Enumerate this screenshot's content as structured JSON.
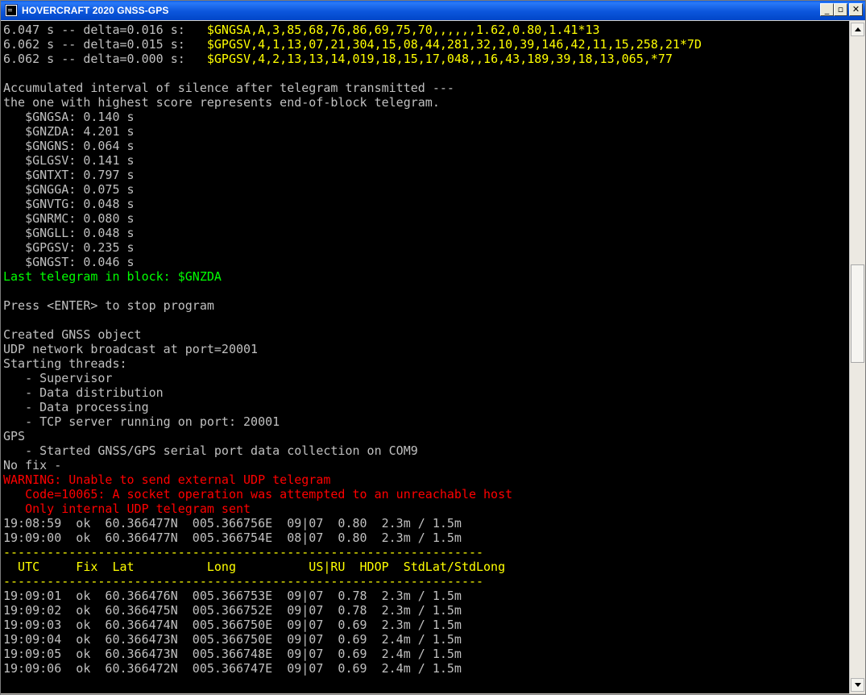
{
  "window": {
    "title": "HOVERCRAFT 2020 GNSS-GPS"
  },
  "controls": {
    "minimize": "_",
    "maximize": "▫",
    "close": "✕"
  },
  "console": {
    "lines": [
      {
        "text": "6.047 s -- delta=0.016 s:   ",
        "color": "gray",
        "tail": "$GNGSA,A,3,85,68,76,86,69,75,70,,,,,,1.62,0.80,1.41*13",
        "tail_color": "yellow"
      },
      {
        "text": "6.062 s -- delta=0.015 s:   ",
        "color": "gray",
        "tail": "$GPGSV,4,1,13,07,21,304,15,08,44,281,32,10,39,146,42,11,15,258,21*7D",
        "tail_color": "yellow"
      },
      {
        "text": "6.062 s -- delta=0.000 s:   ",
        "color": "gray",
        "tail": "$GPGSV,4,2,13,13,14,019,18,15,17,048,,16,43,189,39,18,13,065,*77",
        "tail_color": "yellow"
      },
      {
        "text": "",
        "color": "gray"
      },
      {
        "text": "Accumulated interval of silence after telegram transmitted ---",
        "color": "gray"
      },
      {
        "text": "the one with highest score represents end-of-block telegram.",
        "color": "gray"
      },
      {
        "text": "   $GNGSA: 0.140 s",
        "color": "gray"
      },
      {
        "text": "   $GNZDA: 4.201 s",
        "color": "gray"
      },
      {
        "text": "   $GNGNS: 0.064 s",
        "color": "gray"
      },
      {
        "text": "   $GLGSV: 0.141 s",
        "color": "gray"
      },
      {
        "text": "   $GNTXT: 0.797 s",
        "color": "gray"
      },
      {
        "text": "   $GNGGA: 0.075 s",
        "color": "gray"
      },
      {
        "text": "   $GNVTG: 0.048 s",
        "color": "gray"
      },
      {
        "text": "   $GNRMC: 0.080 s",
        "color": "gray"
      },
      {
        "text": "   $GNGLL: 0.048 s",
        "color": "gray"
      },
      {
        "text": "   $GPGSV: 0.235 s",
        "color": "gray"
      },
      {
        "text": "   $GNGST: 0.046 s",
        "color": "gray"
      },
      {
        "text": "Last telegram in block: $GNZDA",
        "color": "green"
      },
      {
        "text": "",
        "color": "gray"
      },
      {
        "text": "Press <ENTER> to stop program",
        "color": "gray"
      },
      {
        "text": "",
        "color": "gray"
      },
      {
        "text": "Created GNSS object",
        "color": "gray"
      },
      {
        "text": "UDP network broadcast at port=20001",
        "color": "gray"
      },
      {
        "text": "Starting threads:",
        "color": "gray"
      },
      {
        "text": "   - Supervisor",
        "color": "gray"
      },
      {
        "text": "   - Data distribution",
        "color": "gray"
      },
      {
        "text": "   - Data processing",
        "color": "gray"
      },
      {
        "text": "   - TCP server running on port: 20001",
        "color": "gray"
      },
      {
        "text": "GPS",
        "color": "gray"
      },
      {
        "text": "   - Started GNSS/GPS serial port data collection on COM9",
        "color": "gray"
      },
      {
        "text": "No fix -",
        "color": "gray"
      },
      {
        "text": "WARNING: Unable to send external UDP telegram",
        "color": "red"
      },
      {
        "text": "   Code=10065: A socket operation was attempted to an unreachable host",
        "color": "red"
      },
      {
        "text": "   Only internal UDP telegram sent",
        "color": "red"
      },
      {
        "text": "19:08:59  ok  60.366477N  005.366756E  09|07  0.80  2.3m / 1.5m",
        "color": "gray"
      },
      {
        "text": "19:09:00  ok  60.366477N  005.366754E  08|07  0.80  2.3m / 1.5m",
        "color": "gray"
      },
      {
        "text": "------------------------------------------------------------------",
        "color": "yellow"
      },
      {
        "text": "  UTC     Fix  Lat          Long          US|RU  HDOP  StdLat/StdLong",
        "color": "yellow"
      },
      {
        "text": "------------------------------------------------------------------",
        "color": "yellow"
      },
      {
        "text": "19:09:01  ok  60.366476N  005.366753E  09|07  0.78  2.3m / 1.5m",
        "color": "gray"
      },
      {
        "text": "19:09:02  ok  60.366475N  005.366752E  09|07  0.78  2.3m / 1.5m",
        "color": "gray"
      },
      {
        "text": "19:09:03  ok  60.366474N  005.366750E  09|07  0.69  2.3m / 1.5m",
        "color": "gray"
      },
      {
        "text": "19:09:04  ok  60.366473N  005.366750E  09|07  0.69  2.4m / 1.5m",
        "color": "gray"
      },
      {
        "text": "19:09:05  ok  60.366473N  005.366748E  09|07  0.69  2.4m / 1.5m",
        "color": "gray"
      },
      {
        "text": "19:09:06  ok  60.366472N  005.366747E  09|07  0.69  2.4m / 1.5m",
        "color": "gray"
      }
    ]
  },
  "colors": {
    "background": "#000000",
    "gray": "#c0c0c0",
    "yellow": "#ffff00",
    "green": "#00ff00",
    "red": "#ff0000",
    "titlebar": "#0054e3"
  },
  "scrollbar": {
    "position_fraction": 0.42
  }
}
